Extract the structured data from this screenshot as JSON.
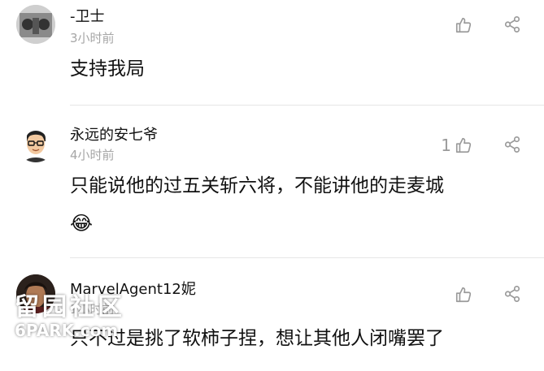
{
  "comments": [
    {
      "username": "-卫士",
      "time": "3小时前",
      "content": "支持我局",
      "like_count": "",
      "avatar": "guard-avatar"
    },
    {
      "username": "永远的安七爷",
      "time": "4小时前",
      "content": "只能说他的过五关斩六将，不能讲他的走麦城",
      "emoji": "😂",
      "like_count": "1",
      "avatar": "cartoon-man-avatar"
    },
    {
      "username": "MarvelAgent12妮",
      "time": "1小时前",
      "content": "只不过是挑了软柿子捏，想让其他人闭嘴罢了",
      "like_count": "",
      "avatar": "photo-avatar"
    }
  ],
  "watermark": {
    "chinese": "留园社区",
    "site": "6PARK.com"
  },
  "colors": {
    "text": "#111111",
    "meta": "#a6a6a6",
    "icon": "#9a9a9a",
    "divider": "#e6e6e6"
  }
}
